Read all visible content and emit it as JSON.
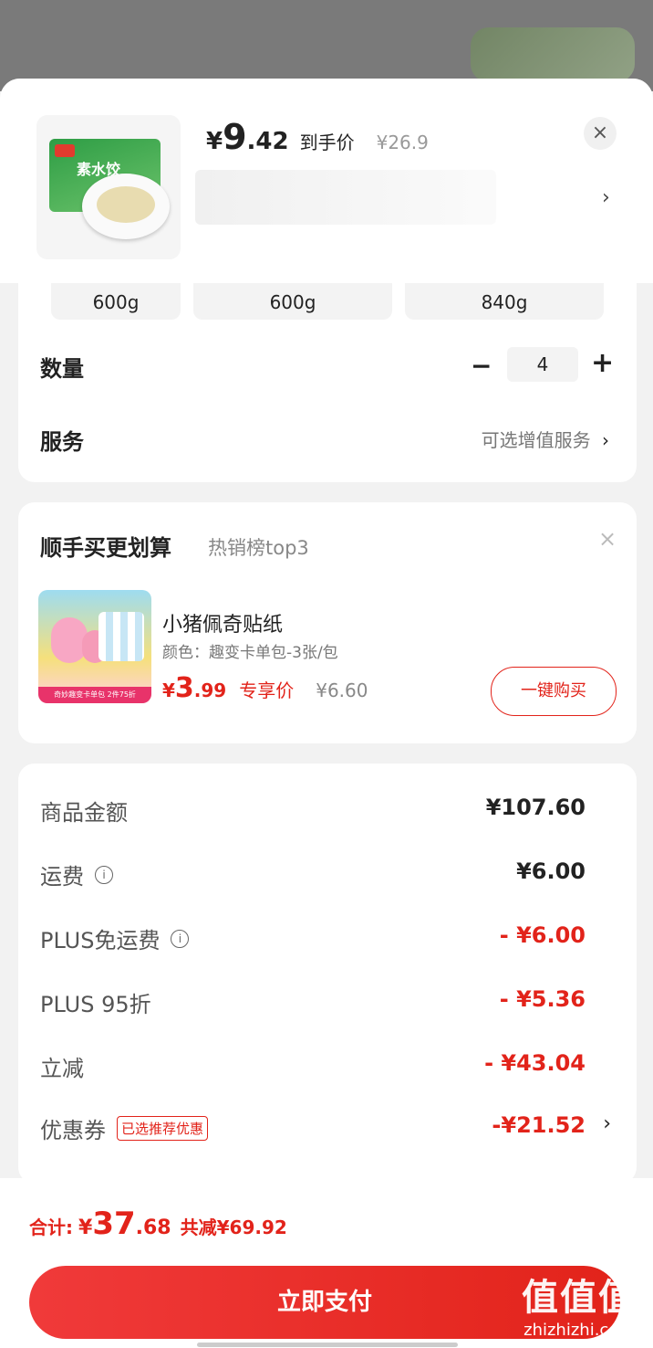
{
  "product": {
    "price_symbol": "¥",
    "price_int": "9",
    "price_dec": ".42",
    "price_label": "到手价",
    "original_price": "¥26.9",
    "image_text": "素水饺"
  },
  "specs": [
    "600g",
    "600g",
    "840g"
  ],
  "quantity": {
    "label": "数量",
    "minus": "−",
    "value": "4",
    "plus": "+"
  },
  "service": {
    "label": "服务",
    "value": "可选增值服务"
  },
  "addon": {
    "title": "顺手买更划算",
    "subtitle": "热销榜top3",
    "name": "小猪佩奇贴纸",
    "color": "颜色：趣变卡单包-3张/包",
    "price_symbol": "¥",
    "price_int": "3",
    "price_dec": ".99",
    "price_tag": "专享价",
    "original_price": "¥6.60",
    "button": "一键购买",
    "image_band": "奇妙趣变卡单包  2件75折"
  },
  "fees": [
    {
      "label": "商品金额",
      "value": "¥107.60"
    },
    {
      "label": "运费",
      "value": "¥6.00"
    },
    {
      "label": "PLUS免运费",
      "value": "- ¥6.00"
    },
    {
      "label": "PLUS 95折",
      "value": "- ¥5.36"
    },
    {
      "label": "立减",
      "value": "- ¥43.04"
    },
    {
      "label": "优惠券",
      "tag": "已选推荐优惠",
      "value": "-¥21.52"
    }
  ],
  "total": {
    "label": "合计:",
    "symbol": "¥",
    "int": "37",
    "dec": ".68",
    "reduced": "共减¥69.92"
  },
  "pay_button": "立即支付",
  "watermark": {
    "big": "值值值",
    "small": "zhizhizhi.com"
  },
  "colors": {
    "accent": "#e2231a"
  },
  "icons": {
    "close": "×",
    "chevron": "›",
    "info": "i"
  }
}
